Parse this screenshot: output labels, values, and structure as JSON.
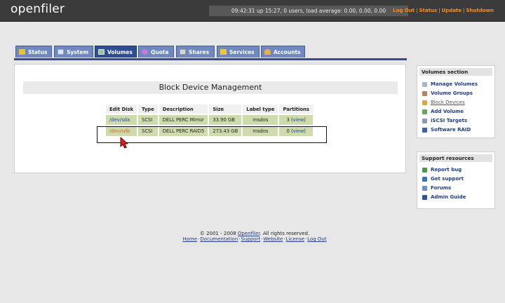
{
  "header": {
    "logo": "openfiler",
    "uptime": "09:42:31 up 15:27, 0 users, load average: 0.00, 0.00, 0.00",
    "links": [
      "Log Out",
      "Status",
      "Update",
      "Shutdown"
    ]
  },
  "tabs": [
    {
      "label": "Status",
      "icon": "status-icon",
      "active": false
    },
    {
      "label": "System",
      "icon": "system-icon",
      "active": false
    },
    {
      "label": "Volumes",
      "icon": "volumes-icon",
      "active": true
    },
    {
      "label": "Quota",
      "icon": "quota-icon",
      "active": false
    },
    {
      "label": "Shares",
      "icon": "shares-icon",
      "active": false
    },
    {
      "label": "Services",
      "icon": "services-icon",
      "active": false
    },
    {
      "label": "Accounts",
      "icon": "accounts-icon",
      "active": false
    }
  ],
  "main": {
    "title": "Block Device Management",
    "columns": [
      "Edit Disk",
      "Type",
      "Description",
      "Size",
      "Label type",
      "Partitions"
    ],
    "rows": [
      {
        "disk": "/dev/sda",
        "type": "SCSI",
        "description": "DELL PERC Mirror",
        "size": "33.90 GB",
        "label": "msdos",
        "partitions": "3",
        "view": "view"
      },
      {
        "disk": "/dev/sdb",
        "type": "SCSI",
        "description": "DELL PERC RAID5",
        "size": "273.43 GB",
        "label": "msdos",
        "partitions": "0",
        "view": "view"
      }
    ]
  },
  "sidebar": {
    "volumes": {
      "title": "Volumes section",
      "items": [
        "Manage Volumes",
        "Volume Groups",
        "Block Devices",
        "Add Volume",
        "iSCSI Targets",
        "Software RAID"
      ]
    },
    "support": {
      "title": "Support resources",
      "items": [
        "Report bug",
        "Get support",
        "Forums",
        "Admin Guide"
      ]
    }
  },
  "footer": {
    "copyright": "© 2001 - 2008 ",
    "brand": "Openfiler",
    "rights": ". All rights reserved.",
    "links": [
      "Home",
      "Documentation",
      "Support",
      "Website",
      "License",
      "Log Out"
    ]
  },
  "colors": {
    "accent": "#ff8c1a",
    "tab": "#6f88c0",
    "tab_active": "#2f4e92",
    "row": "#cddcaa",
    "link": "#1f3d88"
  }
}
